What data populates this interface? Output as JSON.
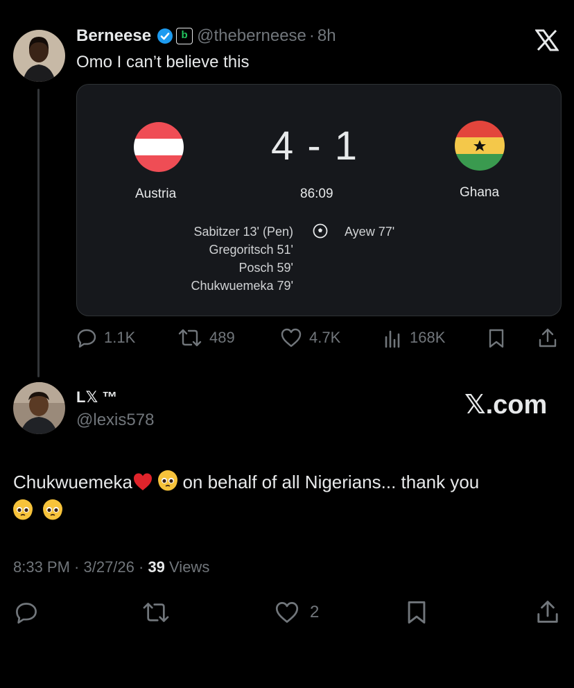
{
  "tweet": {
    "author_name": "Berneese",
    "handle": "@theberneese",
    "separator": "·",
    "time": "8h",
    "text": "Omo I can’t believe this",
    "badge_letter": "b",
    "stats": {
      "replies": "1.1K",
      "retweets": "489",
      "likes": "4.7K",
      "views": "168K"
    }
  },
  "match_card": {
    "score": "4 - 1",
    "clock": "86:09",
    "home_team": "Austria",
    "away_team": "Ghana",
    "home_scorers": [
      "Sabitzer 13' (Pen)",
      "Gregoritsch 51'",
      "Posch 59'",
      "Chukwuemeka 79'"
    ],
    "away_scorers": [
      "Ayew 77'"
    ]
  },
  "reply": {
    "author_name": "L𝕏 ™",
    "handle": "@lexis578",
    "text_part1": "Chukwuemeka",
    "text_part2": " on behalf of all Nigerians... thank you",
    "timestamp": "8:33 PM · 3/27/26 · ",
    "views_count": "39",
    "views_label": " Views",
    "likes": "2"
  },
  "brand": {
    "xcom": "𝕏.com"
  },
  "colors": {
    "background": "#000000",
    "card": "#16181c",
    "verified": "#1d9bf0",
    "muted": "#71767b"
  }
}
